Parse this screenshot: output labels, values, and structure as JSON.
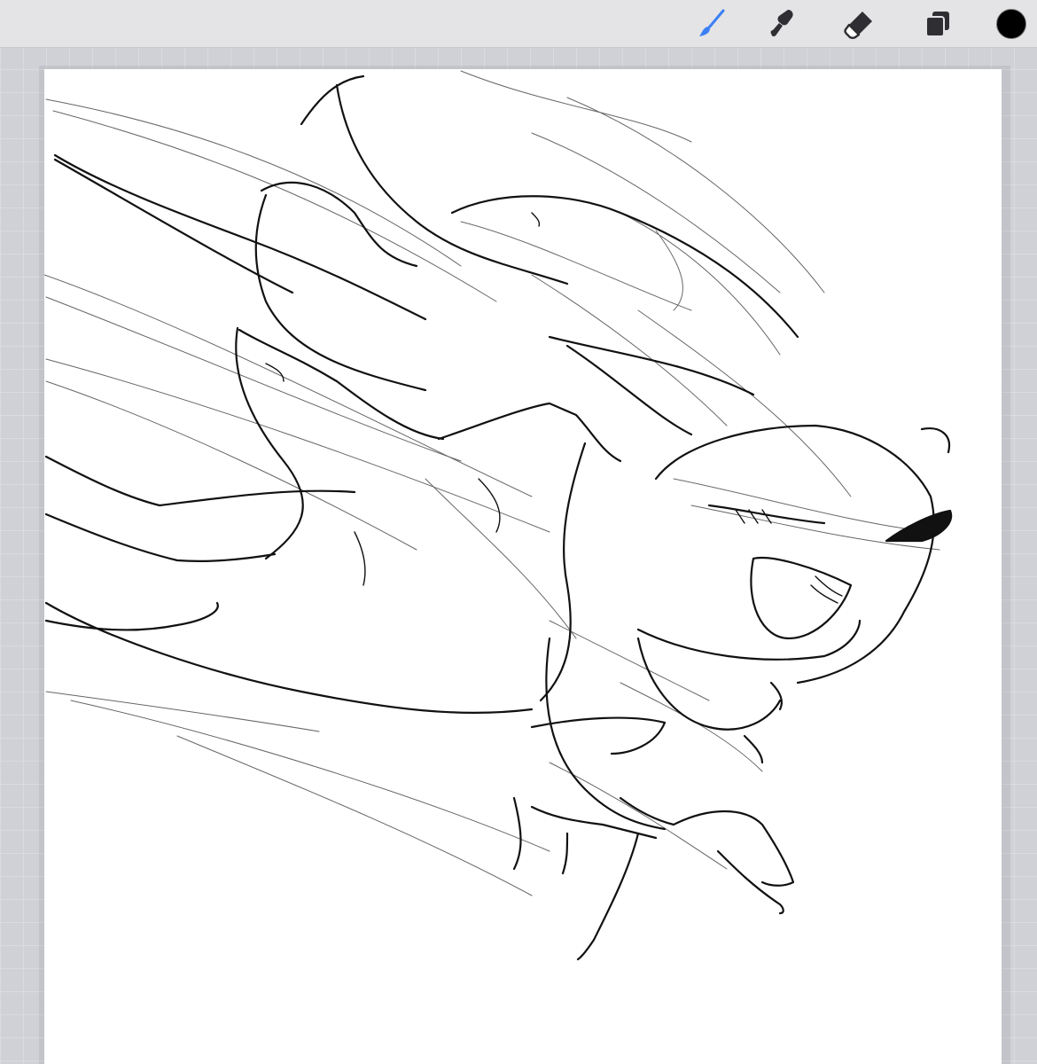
{
  "toolbar": {
    "tools": [
      {
        "id": "brush",
        "icon": "brush-icon",
        "active": true,
        "color": "#3b7ff5"
      },
      {
        "id": "smudge",
        "icon": "smudge-icon",
        "active": false,
        "color": "#2f2f33"
      },
      {
        "id": "eraser",
        "icon": "eraser-icon",
        "active": false,
        "color": "#2f2f33"
      },
      {
        "id": "layers",
        "icon": "layers-icon",
        "active": false,
        "color": "#2f2f33"
      },
      {
        "id": "color",
        "icon": "color-swatch",
        "active": false,
        "color": "#000000"
      }
    ]
  },
  "canvas": {
    "background": "#ffffff",
    "content": "sketch"
  },
  "colors": {
    "accent": "#3b7ff5",
    "current_color": "#000000",
    "toolbar_bg": "#e4e4e6",
    "workspace_bg": "#cfd1d6"
  }
}
